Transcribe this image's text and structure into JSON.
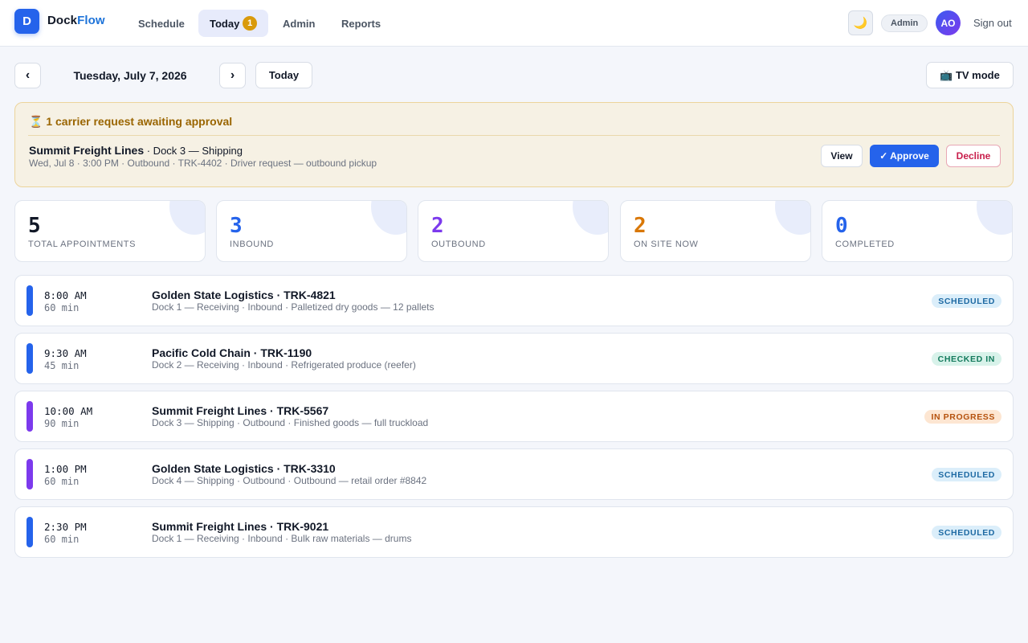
{
  "app": {
    "logo_letter": "D",
    "brand_part1": "Dock",
    "brand_part2": "Flow"
  },
  "nav": {
    "items": [
      {
        "label": "Schedule"
      },
      {
        "label": "Today",
        "badge": "1"
      },
      {
        "label": "Admin"
      },
      {
        "label": "Reports"
      }
    ]
  },
  "header": {
    "theme_icon": "moon-icon",
    "theme_glyph": "🌙",
    "role": "Admin",
    "avatar_initials": "AO",
    "signout": "Sign out"
  },
  "date_nav": {
    "prev": "‹",
    "next": "›",
    "date": "Tuesday, July 7, 2026",
    "today": "Today",
    "tv_mode": "📺 TV mode"
  },
  "approval": {
    "title": "⏳ 1 carrier request awaiting approval",
    "carrier": "Summit Freight Lines",
    "dock": " · Dock 3 — Shipping",
    "details": "Wed, Jul 8 · 3:00 PM · Outbound · TRK-4402 · Driver request — outbound pickup",
    "view": "View",
    "approve": "✓ Approve",
    "decline": "Decline"
  },
  "stats": [
    {
      "value": "5",
      "label": "TOTAL APPOINTMENTS",
      "color": "#111827"
    },
    {
      "value": "3",
      "label": "INBOUND",
      "color": "#2563eb"
    },
    {
      "value": "2",
      "label": "OUTBOUND",
      "color": "#7c3aed"
    },
    {
      "value": "2",
      "label": "ON SITE NOW",
      "color": "#d97706"
    },
    {
      "value": "0",
      "label": "COMPLETED",
      "color": "#2563eb"
    }
  ],
  "appointments": [
    {
      "time": "8:00 AM",
      "duration": "60 min",
      "title": "Golden State Logistics · TRK-4821",
      "details": "Dock 1 — Receiving · Inbound · Palletized dry goods — 12 pallets",
      "status": "SCHEDULED",
      "bar_color": "#2563eb"
    },
    {
      "time": "9:30 AM",
      "duration": "45 min",
      "title": "Pacific Cold Chain · TRK-1190",
      "details": "Dock 2 — Receiving · Inbound · Refrigerated produce (reefer)",
      "status": "CHECKED IN",
      "bar_color": "#2563eb"
    },
    {
      "time": "10:00 AM",
      "duration": "90 min",
      "title": "Summit Freight Lines · TRK-5567",
      "details": "Dock 3 — Shipping · Outbound · Finished goods — full truckload",
      "status": "IN PROGRESS",
      "bar_color": "#7c3aed"
    },
    {
      "time": "1:00 PM",
      "duration": "60 min",
      "title": "Golden State Logistics · TRK-3310",
      "details": "Dock 4 — Shipping · Outbound · Outbound — retail order #8842",
      "status": "SCHEDULED",
      "bar_color": "#7c3aed"
    },
    {
      "time": "2:30 PM",
      "duration": "60 min",
      "title": "Summit Freight Lines · TRK-9021",
      "details": "Dock 1 — Receiving · Inbound · Bulk raw materials — drums",
      "status": "SCHEDULED",
      "bar_color": "#2563eb"
    }
  ],
  "status_colors": {
    "SCHEDULED": {
      "bg": "#dbeefa",
      "fg": "#1e6aa3"
    },
    "CHECKED IN": {
      "bg": "#d8f2ea",
      "fg": "#137a5c"
    },
    "IN PROGRESS": {
      "bg": "#fde6d2",
      "fg": "#b5520e"
    }
  }
}
